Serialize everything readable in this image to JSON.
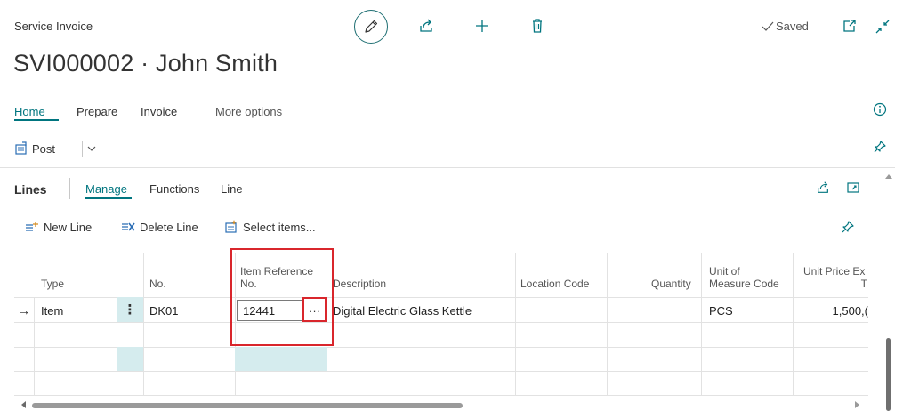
{
  "header": {
    "caption": "Service Invoice",
    "title": "SVI000002 · John Smith",
    "saved_label": "Saved"
  },
  "action_bar": {
    "tabs": [
      "Home",
      "Prepare",
      "Invoice",
      "More options"
    ],
    "active_tab": "Home",
    "post_label": "Post"
  },
  "lines": {
    "title": "Lines",
    "tabs": [
      "Manage",
      "Functions",
      "Line"
    ],
    "active_tab": "Manage",
    "actions": {
      "new_line": "New Line",
      "delete_line": "Delete Line",
      "select_items": "Select items..."
    },
    "columns": {
      "type": "Type",
      "no": "No.",
      "item_reference_line1": "Item Reference",
      "item_reference_line2": "No.",
      "description": "Description",
      "location_code": "Location Code",
      "quantity": "Quantity",
      "uom_line1": "Unit of",
      "uom_line2": "Measure Code",
      "unit_price_line1": "Unit Price Ex",
      "unit_price_line2": "T"
    },
    "rows": [
      {
        "type": "Item",
        "no": "DK01",
        "item_reference_no": "12441",
        "lookup": "···",
        "description": "Digital Electric Glass Kettle",
        "location_code": "",
        "quantity": "",
        "uom": "PCS",
        "unit_price": "1,500,("
      }
    ],
    "row_menu": "⋮",
    "row_indicator": "→"
  },
  "colors": {
    "accent": "#00757f",
    "highlight_red": "#d9262c",
    "selected_cell": "#d5ecee"
  }
}
